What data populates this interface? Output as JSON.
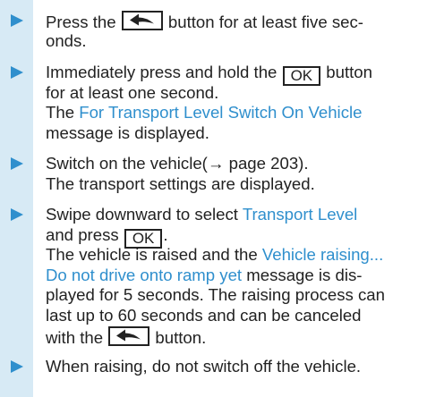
{
  "colors": {
    "accent": "#2f8fcd",
    "sidebar_tint": "#d7eaf5",
    "text": "#222222"
  },
  "icons": {
    "bullet": "triangle-arrow-right-icon",
    "back_key": "back-arrow-icon"
  },
  "steps": [
    {
      "lines": [
        {
          "a": "Press the ",
          "key": "back",
          "b": " button for at least five sec-"
        },
        {
          "a": "onds."
        }
      ]
    },
    {
      "lines": [
        {
          "a": "Immediately press and hold the ",
          "key": "OK",
          "b": " button"
        },
        {
          "a": "for at least one second."
        },
        {
          "a": "The ",
          "h": "For Transport Level Switch On Vehicle"
        },
        {
          "a": "message is displayed."
        }
      ]
    },
    {
      "lines": [
        {
          "a": "Switch on the vehicle(→ page 203)."
        },
        {
          "a": "The transport settings are displayed."
        }
      ]
    },
    {
      "lines": [
        {
          "a": "Swipe downward to select ",
          "h": "Transport Level"
        },
        {
          "a": "and press ",
          "key": "OK",
          "b": "."
        },
        {
          "a": "The vehicle is raised and the ",
          "h": "Vehicle raising..."
        },
        {
          "h": "Do not drive onto ramp yet",
          "a2": " message is dis-"
        },
        {
          "a": "played for 5 seconds. The raising process can"
        },
        {
          "a": "last up to 60 seconds and can be canceled"
        },
        {
          "a": "with the ",
          "key": "back",
          "b": " button."
        }
      ]
    },
    {
      "lines": [
        {
          "a": "When raising, do not switch off the vehicle."
        }
      ]
    }
  ]
}
